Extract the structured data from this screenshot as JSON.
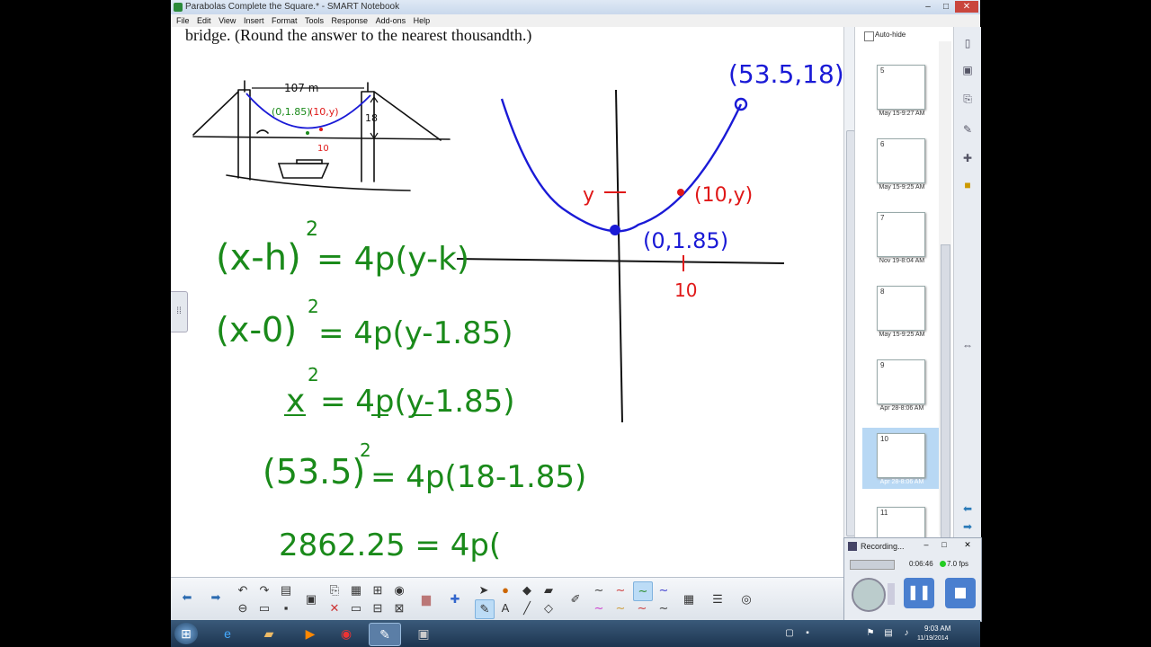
{
  "window": {
    "title": "Parabolas Complete the Square.* - SMART Notebook",
    "buttons": {
      "minimize": "–",
      "maximize": "□",
      "close": "✕"
    }
  },
  "menu": [
    "File",
    "Edit",
    "View",
    "Insert",
    "Format",
    "Tools",
    "Response",
    "Add-ons",
    "Help"
  ],
  "canvas": {
    "prompt_text": "bridge. (Round the answer to the nearest thousandth.)",
    "sketch": {
      "span_label": "107 m",
      "point_vertex": "(0,1.85)",
      "point_ten": "(10,y)",
      "height_label": "18",
      "tick_label": "10"
    },
    "graph": {
      "point_top": "(53.5,18)",
      "point_ten": "(10,y)",
      "point_vertex": "(0,1.85)",
      "y_mark": "y",
      "x_tick": "10"
    },
    "equations": {
      "line1_lhs": "(x-h)",
      "line1_exp": "2",
      "line1_rhs": "= 4p(y-k)",
      "line2_lhs": "(x-0)",
      "line2_exp": "2",
      "line2_rhs": "= 4p(y-1.85)",
      "line3_lhs": "x",
      "line3_exp": "2",
      "line3_rhs": "= 4p(y-1.85)",
      "line4_lhs": "(53.5)",
      "line4_exp": "2",
      "line4_rhs": "= 4p(18-1.85)",
      "line5": "2862.25 = 4p("
    }
  },
  "side_panel": {
    "autohide_label": "Auto-hide",
    "pages": [
      {
        "num": "5",
        "caption": "May 15-9:27 AM"
      },
      {
        "num": "6",
        "caption": "May 15-9:25 AM"
      },
      {
        "num": "7",
        "caption": "Nov 19-8:04 AM"
      },
      {
        "num": "8",
        "caption": "May 15-9:25 AM"
      },
      {
        "num": "9",
        "caption": "Apr 28-8:06 AM"
      },
      {
        "num": "10",
        "caption": "Apr 28-8:06 AM"
      },
      {
        "num": "11",
        "caption": ""
      }
    ]
  },
  "recorder": {
    "title": "Recording...",
    "elapsed": "0:06:46",
    "fps": "7.0 fps"
  },
  "taskbar": {
    "time": "9:03 AM",
    "date": "11/19/2014"
  },
  "colors": {
    "ink_green": "#1a8a1a",
    "ink_blue": "#1a1ad6",
    "ink_red": "#e01818",
    "ink_black": "#111111"
  }
}
